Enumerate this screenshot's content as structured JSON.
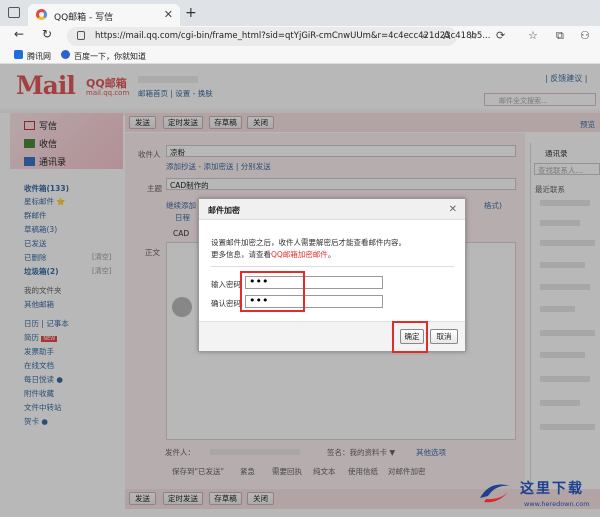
{
  "browser": {
    "tab_title": "QQ邮箱 - 写信",
    "url": "https://mail.qq.com/cgi-bin/frame_html?sid=qtYjGiR-cmCnwUUm&r=4c4ecc421d23c418b5...",
    "bookmarks": [
      "腾讯网",
      "百度一下，你就知道"
    ]
  },
  "header": {
    "logo": "Mail",
    "logo_cn": "QQ邮箱",
    "logo_domain": "mail.qq.com",
    "nav": "邮箱首页 | 设置 - 换肤",
    "top_right": "| 反馈建议 |",
    "search_placeholder": "邮件全文搜索..."
  },
  "sidebar": {
    "write": "写信",
    "receive": "收信",
    "contacts": "通讯录",
    "folders": [
      {
        "label": "收件箱(133)",
        "bold": true
      },
      {
        "label": "星标邮件 ⭐"
      },
      {
        "label": "群邮件"
      },
      {
        "label": "草稿箱(3)"
      },
      {
        "label": "已发送"
      },
      {
        "label": "已删除",
        "action": "[清空]"
      },
      {
        "label": "垃圾箱(2)",
        "action": "[清空]"
      }
    ],
    "my_folders": "我的文件夹",
    "other_mail": "其他邮箱",
    "apps": [
      "日历 | 记事本",
      "简历",
      "发票助手",
      "在线文档",
      "每日悦读 ●",
      "附件收藏",
      "文件中转站",
      "贺卡 ●"
    ],
    "resume_badge": "NEW"
  },
  "toolbar": {
    "buttons": [
      "发送",
      "定时发送",
      "存草稿",
      "关闭"
    ],
    "preview": "预览"
  },
  "compose": {
    "to_label": "收件人",
    "to_value": "凉粉",
    "links": "添加抄送 - 添加密送 | 分别发送",
    "subject_label": "主题",
    "subject_value": "CAD制作的",
    "attach_hint": "继续添加",
    "attach_suffix": "格式)",
    "body_label": "正文",
    "attach_name": "CAD",
    "calendar": "日程"
  },
  "footer": {
    "sender_label": "发件人：",
    "signature": "签名：我的资料卡 ▼",
    "other": "其他选项",
    "options": [
      "保存到\"已发送\"",
      "紧急",
      "需要回执",
      "纯文本",
      "使用信纸",
      "对邮件加密"
    ]
  },
  "contacts_panel": {
    "title": "通讯录",
    "search": "查找联系人...",
    "recent": "最近联系"
  },
  "dialog": {
    "title": "邮件加密",
    "line1": "设置邮件加密之后，收件人需要解密后才能查看邮件内容。",
    "line2_prefix": "更多信息，请查看",
    "line2_link": "QQ邮箱加密邮件",
    "line2_suffix": "。",
    "pwd_label": "输入密码",
    "confirm_label": "确认密码",
    "pwd_value": "•••",
    "confirm_value": "•••",
    "ok": "确定",
    "cancel": "取消"
  },
  "watermark": {
    "name": "这里下载",
    "url": "www.heredown.com"
  }
}
